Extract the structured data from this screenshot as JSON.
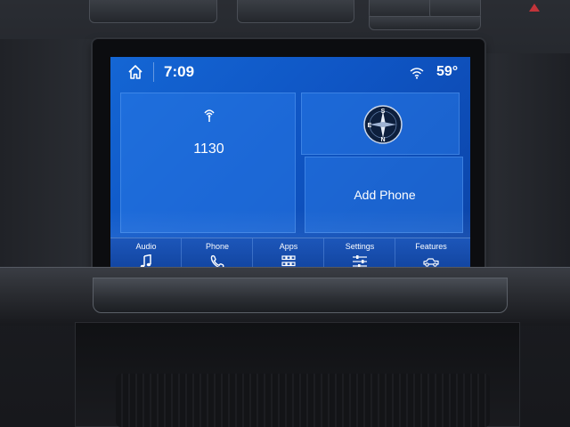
{
  "status_bar": {
    "time": "7:09",
    "temperature": "59°",
    "home_icon": "home-icon",
    "signal_icon": "wifi-signal-icon"
  },
  "tiles": {
    "radio": {
      "station": "1130",
      "icon": "radio-antenna-icon"
    },
    "navigation": {
      "icon": "compass-icon",
      "compass_letters": [
        "S",
        "E",
        "N"
      ]
    },
    "phone": {
      "label": "Add Phone"
    }
  },
  "bottom_nav": [
    {
      "label": "Audio",
      "icon": "music-note-icon"
    },
    {
      "label": "Phone",
      "icon": "phone-handset-icon"
    },
    {
      "label": "Apps",
      "icon": "apps-grid-icon"
    },
    {
      "label": "Settings",
      "icon": "sliders-icon"
    },
    {
      "label": "Features",
      "icon": "truck-icon"
    }
  ],
  "colors": {
    "screen_background": "#0f55c4",
    "tile_background": "#2878e6",
    "text": "#ffffff"
  }
}
